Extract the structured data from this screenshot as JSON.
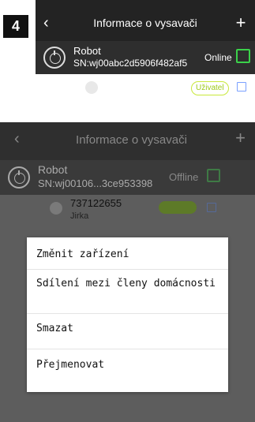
{
  "step_badge": "4",
  "screen1": {
    "header": {
      "back_icon": "chevron-left-icon",
      "title": "Informace o vysavači",
      "add_icon": "plus-icon"
    },
    "device": {
      "icon": "robot-vacuum-icon",
      "name": "Robot",
      "serial": "SN:wj00abc2d5906f482af5",
      "status": "Online",
      "edit_icon": "edit-icon"
    },
    "user": {
      "avatar_icon": "avatar-icon",
      "role_badge": "Uživatel",
      "edit_icon": "edit-icon"
    }
  },
  "screen2": {
    "header": {
      "back_icon": "chevron-left-icon",
      "title": "Informace o vysavači",
      "add_icon": "plus-icon"
    },
    "device": {
      "icon": "robot-vacuum-icon",
      "name": "Robot",
      "serial": "SN:wj00106...3ce953398",
      "status": "Offline",
      "edit_icon": "edit-icon"
    },
    "user": {
      "avatar_icon": "avatar-icon",
      "phone": "737122655",
      "name": "Jirka",
      "edit_icon": "edit-icon"
    },
    "menu": {
      "items": [
        {
          "label": "Změnit zařízení"
        },
        {
          "label": "Sdílení mezi členy domácnosti"
        },
        {
          "label": "Smazat"
        },
        {
          "label": "Přejmenovat"
        }
      ]
    }
  },
  "colors": {
    "accent_green": "#3bd14a",
    "role_badge_border": "#c8e83a",
    "header_bg": "#232323",
    "overlay_bg": "#5d5d5d"
  }
}
